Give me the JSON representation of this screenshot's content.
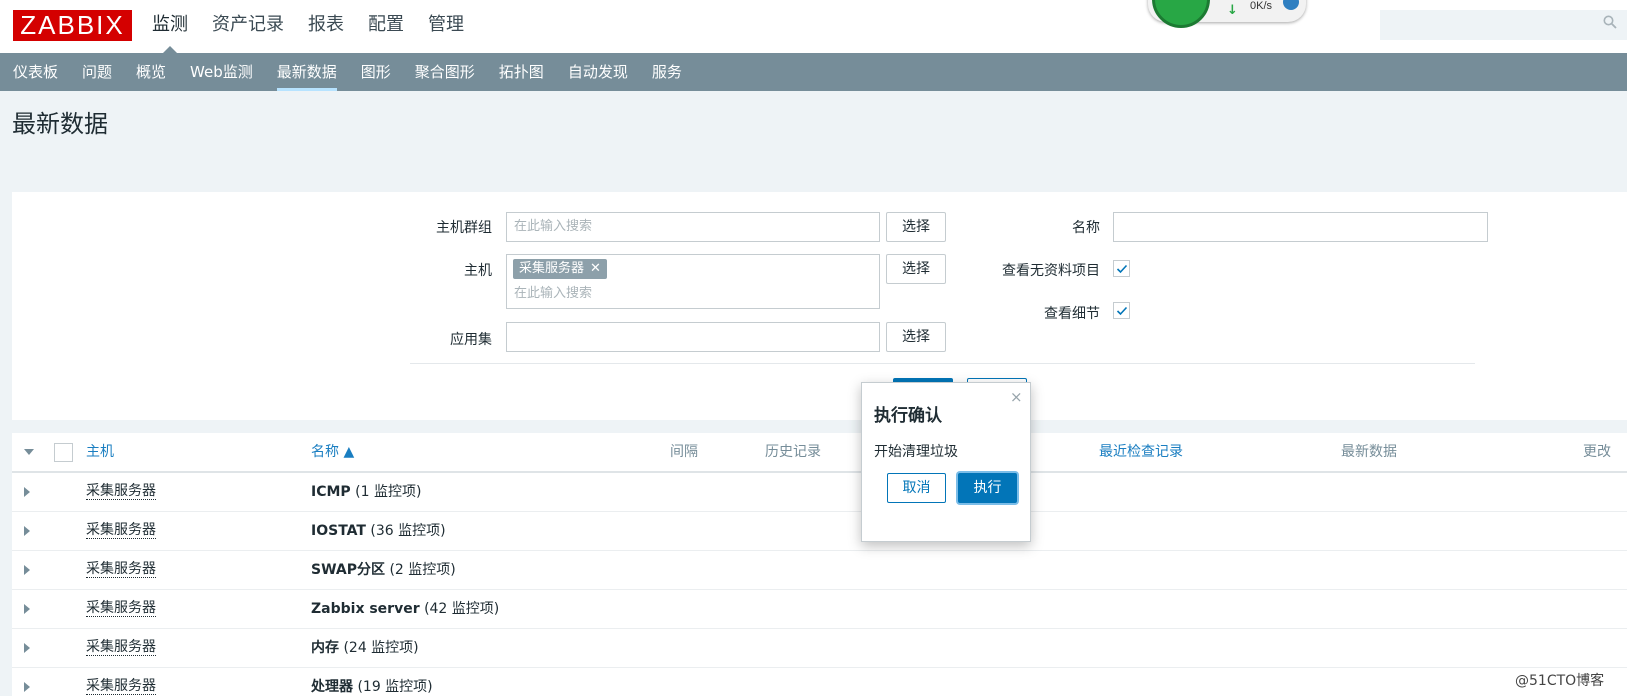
{
  "header": {
    "logo": "ZABBIX",
    "menu": [
      "监测",
      "资产记录",
      "报表",
      "配置",
      "管理"
    ],
    "speed": "0K/s",
    "search_placeholder": ""
  },
  "subnav": [
    "仪表板",
    "问题",
    "概览",
    "Web监测",
    "最新数据",
    "图形",
    "聚合图形",
    "拓扑图",
    "自动发现",
    "服务"
  ],
  "page_title": "最新数据",
  "filter": {
    "host_group_label": "主机群组",
    "host_group_placeholder": "在此输入搜索",
    "host_label": "主机",
    "host_tag": "采集服务器",
    "host_placeholder": "在此输入搜索",
    "app_label": "应用集",
    "select_label": "选择",
    "name_label": "名称",
    "show_no_data_label": "查看无资料项目",
    "show_details_label": "查看细节"
  },
  "table": {
    "headers": {
      "host": "主机",
      "name": "名称 ▲",
      "interval": "间隔",
      "history": "历史记录",
      "last_check": "最近检查记录",
      "last_value": "最新数据",
      "change": "更改"
    },
    "rows": [
      {
        "host": "采集服务器",
        "app": "ICMP",
        "count": "(1 监控项)"
      },
      {
        "host": "采集服务器",
        "app": "IOSTAT",
        "count": "(36 监控项)"
      },
      {
        "host": "采集服务器",
        "app": "SWAP分区",
        "count": "(2 监控项)"
      },
      {
        "host": "采集服务器",
        "app": "Zabbix server",
        "count": "(42 监控项)"
      },
      {
        "host": "采集服务器",
        "app": "内存",
        "count": "(24 监控项)"
      },
      {
        "host": "采集服务器",
        "app": "处理器",
        "count": "(19 监控项)"
      }
    ]
  },
  "dialog": {
    "title": "执行确认",
    "message": "开始清理垃圾",
    "cancel": "取消",
    "execute": "执行",
    "close": "×"
  },
  "watermark": "@51CTO博客"
}
